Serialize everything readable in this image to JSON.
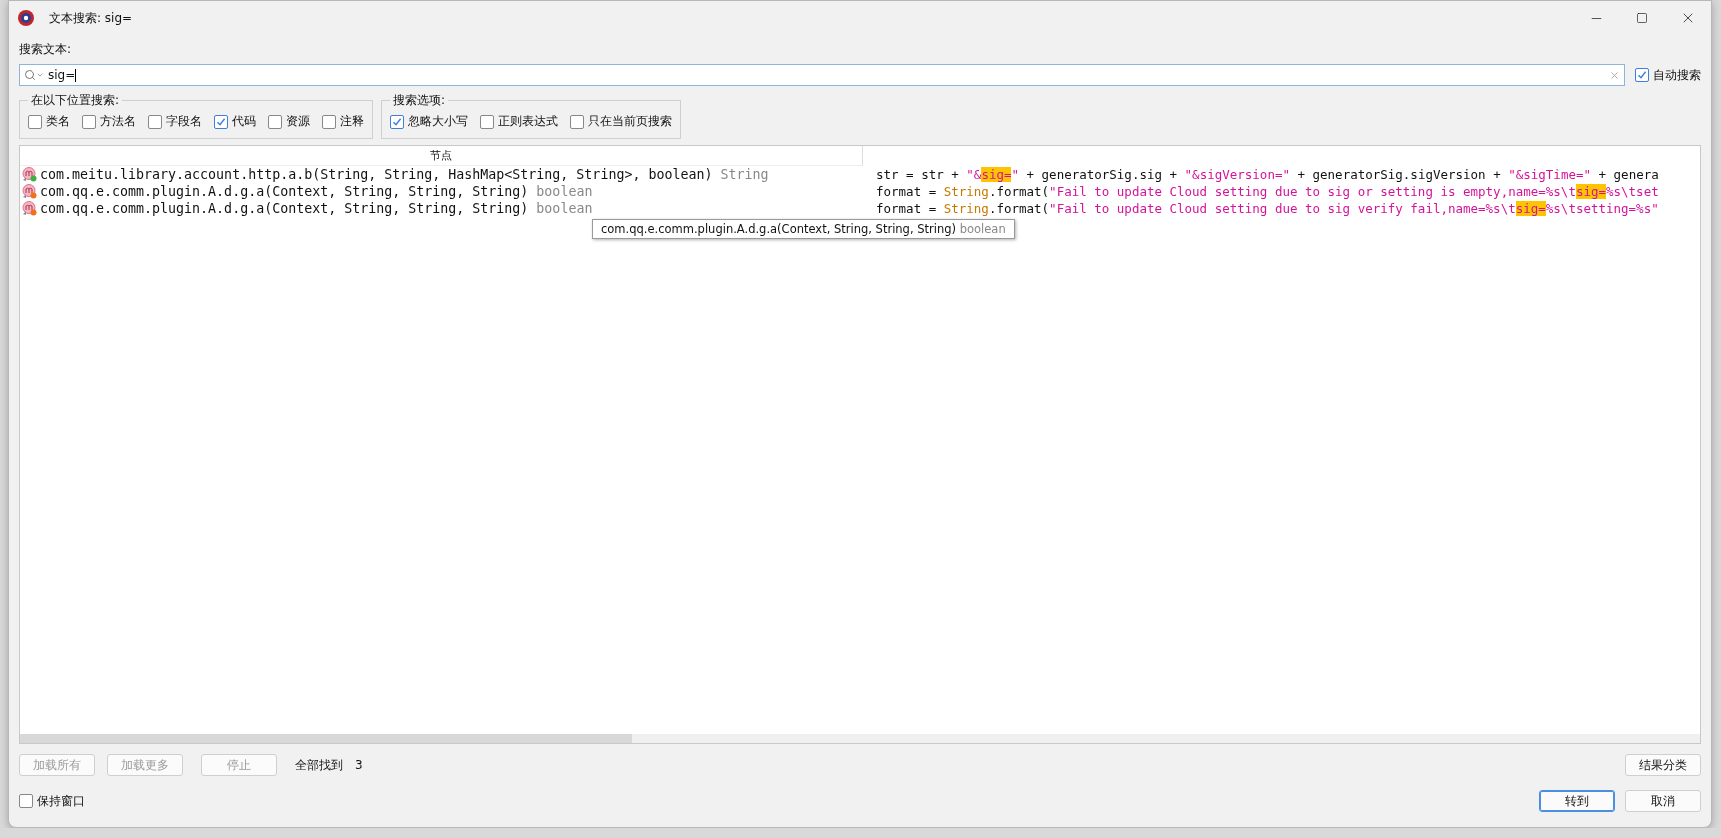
{
  "window": {
    "title": "文本搜索: sig="
  },
  "search": {
    "label": "搜索文本:",
    "value": "sig=",
    "auto_search": {
      "label": "自动搜索",
      "checked": true
    }
  },
  "search_in": {
    "title": "在以下位置搜索:",
    "options": [
      {
        "label": "类名",
        "checked": false
      },
      {
        "label": "方法名",
        "checked": false
      },
      {
        "label": "字段名",
        "checked": false
      },
      {
        "label": "代码",
        "checked": true
      },
      {
        "label": "资源",
        "checked": false
      },
      {
        "label": "注释",
        "checked": false
      }
    ]
  },
  "search_options": {
    "title": "搜索选项:",
    "options": [
      {
        "label": "忽略大小写",
        "checked": true
      },
      {
        "label": "正则表达式",
        "checked": false
      },
      {
        "label": "只在当前页搜索",
        "checked": false
      }
    ]
  },
  "results": {
    "columns": [
      "节点"
    ],
    "rows": [
      {
        "node": "com.meitu.library.account.http.a.b(String, String, HashMap<String, String>, boolean)",
        "return_type": "String",
        "color": "#3cb043",
        "code": [
          {
            "kind": "plain",
            "text": "str = str + "
          },
          {
            "kind": "string",
            "text": "\"&"
          },
          {
            "kind": "match",
            "text": "sig="
          },
          {
            "kind": "string",
            "text": "\""
          },
          {
            "kind": "plain",
            "text": " + generatorSig.sig + "
          },
          {
            "kind": "string",
            "text": "\"&sigVersion=\""
          },
          {
            "kind": "plain",
            "text": " + generatorSig.sigVersion + "
          },
          {
            "kind": "string",
            "text": "\"&sigTime=\""
          },
          {
            "kind": "plain",
            "text": " + genera"
          }
        ]
      },
      {
        "node": "com.qq.e.comm.plugin.A.d.g.a(Context, String, String, String)",
        "return_type": "boolean",
        "color": "#f07020",
        "code": [
          {
            "kind": "plain",
            "text": "format = "
          },
          {
            "kind": "type",
            "text": "String"
          },
          {
            "kind": "plain",
            "text": ".format("
          },
          {
            "kind": "string",
            "text": "\"Fail to update Cloud setting due to sig or setting is empty,name=%s\\t"
          },
          {
            "kind": "match",
            "text": "sig="
          },
          {
            "kind": "string",
            "text": "%s\\tset"
          }
        ]
      },
      {
        "node": "com.qq.e.comm.plugin.A.d.g.a(Context, String, String, String)",
        "return_type": "boolean",
        "color": "#f07020",
        "code": [
          {
            "kind": "plain",
            "text": "format = "
          },
          {
            "kind": "type",
            "text": "String"
          },
          {
            "kind": "plain",
            "text": ".format("
          },
          {
            "kind": "string",
            "text": "\"Fail to update Cloud setting due to sig verify fail,name=%s\\t"
          },
          {
            "kind": "match",
            "text": "sig="
          },
          {
            "kind": "string",
            "text": "%s\\tsetting=%s\""
          }
        ]
      }
    ]
  },
  "tooltip": {
    "node": "com.qq.e.comm.plugin.A.d.g.a(Context, String, String, String)",
    "return_type": "boolean"
  },
  "load_buttons": [
    {
      "label": "加载所有",
      "disabled": true
    },
    {
      "label": "加载更多",
      "disabled": true
    },
    {
      "label": "停止",
      "disabled": true
    }
  ],
  "found": {
    "label": "全部找到",
    "count": "3"
  },
  "group_button": {
    "label": "结果分类"
  },
  "keep_window": {
    "label": "保持窗口",
    "checked": false
  },
  "dialog_buttons": [
    {
      "label": "转到",
      "default": true
    },
    {
      "label": "取消",
      "default": false
    }
  ]
}
